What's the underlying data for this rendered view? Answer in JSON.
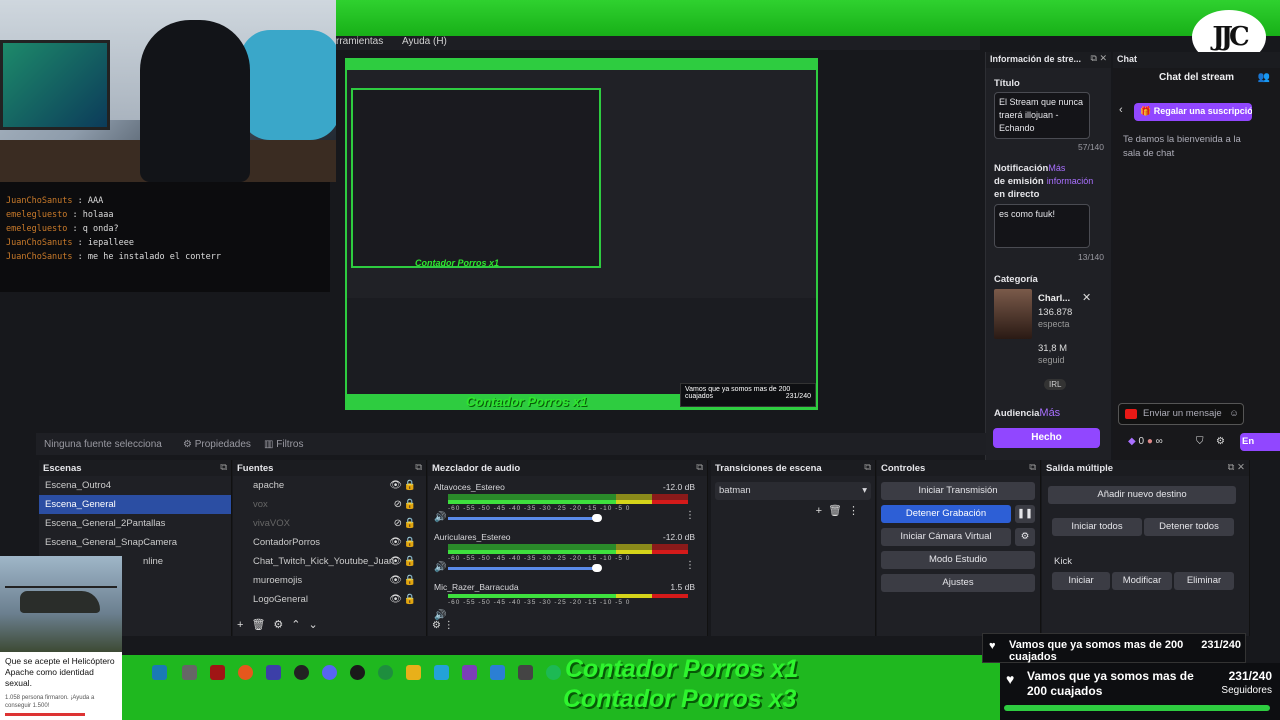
{
  "menu": {
    "item1": "rramientas",
    "item2": "Ayuda (H)"
  },
  "chatlog": [
    {
      "user": "JuanChoSanuts",
      "msg": "AAA"
    },
    {
      "user": "emelegluesto",
      "msg": "holaaa"
    },
    {
      "user": "emelegluesto",
      "msg": "q onda?"
    },
    {
      "user": "JuanChoSanuts",
      "msg": "iepalleee"
    },
    {
      "user": "JuanChoSanuts",
      "msg": "me he instalado el conterr"
    }
  ],
  "nested": {
    "counter": "Contador Porros x1",
    "counter_small": "Contador Porros x1",
    "alert": "Vamos que ya somos mas de 200 cuajados",
    "alert_count": "231/240"
  },
  "logo": "JJC",
  "info": {
    "panel_title": "Información de stre...",
    "title_label": "Título",
    "title_value": "El Stream que nunca traerá illojuan - Echando",
    "title_count": "57/140",
    "notif_label_a": "Notificación",
    "notif_link_a": "Más",
    "notif_label_b": "de emisión",
    "notif_link_b": "información",
    "notif_label_c": "en directo",
    "notif_value": "es como fuuk!",
    "notif_count": "13/140",
    "category_label": "Categoría",
    "category_name": "Charl...",
    "category_viewers": "136.878",
    "category_viewers_lbl": "especta",
    "category_followers": "31,8 M",
    "category_followers_lbl": "seguid",
    "category_tag": "IRL",
    "audience_label": "Audiencia",
    "audience_link": "Más",
    "done": "Hecho"
  },
  "chat": {
    "panel_title": "Chat",
    "header": "Chat del stream",
    "gift": "Regalar una suscripción",
    "welcome": "Te damos la bienvenida a la sala de chat",
    "input_placeholder": "Enviar un mensaje",
    "points": "0",
    "points2": "∞",
    "send": "En"
  },
  "srcbar": {
    "none": "Ninguna fuente selecciona",
    "props": "Propiedades",
    "filters": "Filtros"
  },
  "scenes": {
    "title": "Escenas",
    "items": [
      "Escena_Outro4",
      "Escena_General",
      "Escena_General_2Pantallas",
      "Escena_General_SnapCamera"
    ],
    "extra": "nline"
  },
  "sources": {
    "title": "Fuentes",
    "items": [
      "apache",
      "vox",
      "vivaVOX",
      "ContadorPorros",
      "Chat_Twitch_Kick_Youtube_Juan",
      "muroemojis",
      "LogoGeneral"
    ]
  },
  "mixer": {
    "title": "Mezclador de audio",
    "channels": [
      {
        "name": "Altavoces_Estereo",
        "db": "-12.0 dB"
      },
      {
        "name": "Auriculares_Estereo",
        "db": "-12.0 dB"
      },
      {
        "name": "Mic_Razer_Barracuda",
        "db": "1.5 dB"
      }
    ],
    "ticks": "-60 -55 -50 -45 -40 -35 -30 -25 -20 -15 -10 -5 0"
  },
  "transitions": {
    "title": "Transiciones de escena",
    "selected": "batman"
  },
  "controls": {
    "title": "Controles",
    "start_stream": "Iniciar Transmisión",
    "stop_rec": "Detener Grabación",
    "virtual_cam": "Iniciar Cámara Virtual",
    "studio": "Modo Estudio",
    "settings": "Ajustes"
  },
  "multi": {
    "title": "Salida múltiple",
    "add": "Añadir nuevo destino",
    "start_all": "Iniciar todos",
    "stop_all": "Detener todos",
    "kick": "Kick",
    "start": "Iniciar",
    "modify": "Modificar",
    "delete": "Eliminar"
  },
  "overlay": {
    "counter1": "Contador Porros x1",
    "counter3": "Contador Porros x3",
    "goal_text": "Vamos que ya somos mas de 200 cuajados",
    "goal_count": "231/240",
    "goal_sub": "Seguidores"
  },
  "petition": {
    "title": "Que se acepte el Helicóptero Apache como identidad sexual.",
    "signed": "1.058 persona firmaron. ¡Ayuda a conseguir 1.500!"
  }
}
